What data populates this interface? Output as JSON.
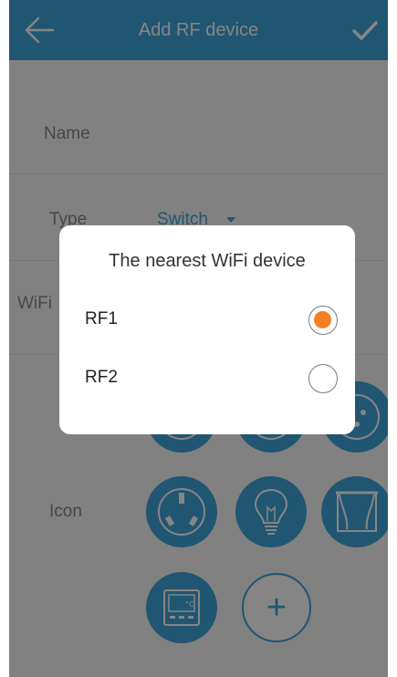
{
  "header": {
    "title": "Add RF device",
    "back_icon": "back-arrow-icon",
    "confirm_icon": "checkmark-icon"
  },
  "form": {
    "name_label": "Name",
    "type_label": "Type",
    "type_value": "Switch",
    "wifi_label": "WiFi",
    "icon_label": "Icon",
    "add_icon_label": "+"
  },
  "icons": {
    "row1": [
      "socket-icon",
      "fan-icon",
      "socket-icon"
    ],
    "row2": [
      "socket-icon",
      "lightbulb-icon",
      "curtain-icon"
    ],
    "row3": [
      "thermostat-icon"
    ]
  },
  "dialog": {
    "title": "The nearest WiFi device",
    "options": [
      {
        "label": "RF1",
        "selected": true
      },
      {
        "label": "RF2",
        "selected": false
      }
    ]
  },
  "colors": {
    "accent": "#3fa5d9",
    "selected_radio": "#f47f20",
    "overlay": "rgba(0,0,0,0.48)"
  }
}
